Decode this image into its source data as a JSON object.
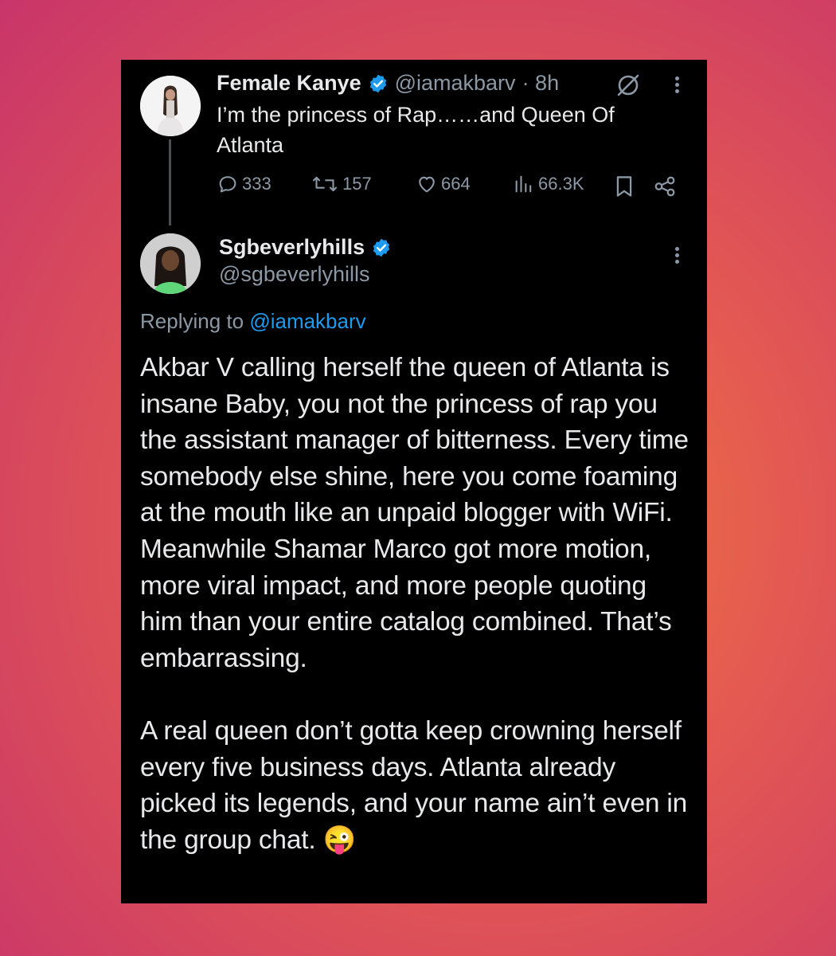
{
  "tweet1": {
    "display_name": "Female Kanye",
    "handle": "@iamakbarv",
    "time": "· 8h",
    "text": "I’m the princess of Rap……and Queen Of Atlanta",
    "stats": {
      "replies": "333",
      "retweets": "157",
      "likes": "664",
      "views": "66.3K"
    }
  },
  "tweet2": {
    "display_name": "Sgbeverlyhills",
    "handle": "@sgbeverlyhills",
    "replying_prefix": "Replying to",
    "replying_to": "@iamakbarv",
    "paragraph1": "Akbar V calling herself the queen of Atlanta is insane Baby, you not the princess of rap you the assistant manager of bitterness. Every time somebody else shine, here you come foaming at the mouth like an unpaid blogger with WiFi. Meanwhile Shamar Marco got more motion, more viral impact, and more people quoting him than your entire catalog combined. That’s embarrassing.",
    "paragraph2": "A real queen don’t gotta keep crowning herself every five business days. Atlanta already picked its legends, and your name ain’t even in the group chat. 😜"
  },
  "colors": {
    "verified": "#1d9bf0",
    "mention": "#1d9bf0",
    "secondary_text": "#8b98a5",
    "card_background": "#000000"
  },
  "icons": [
    "verified-badge-icon",
    "grok-icon",
    "more-icon",
    "reply-icon",
    "retweet-icon",
    "like-icon",
    "views-icon",
    "bookmark-icon",
    "share-icon"
  ]
}
